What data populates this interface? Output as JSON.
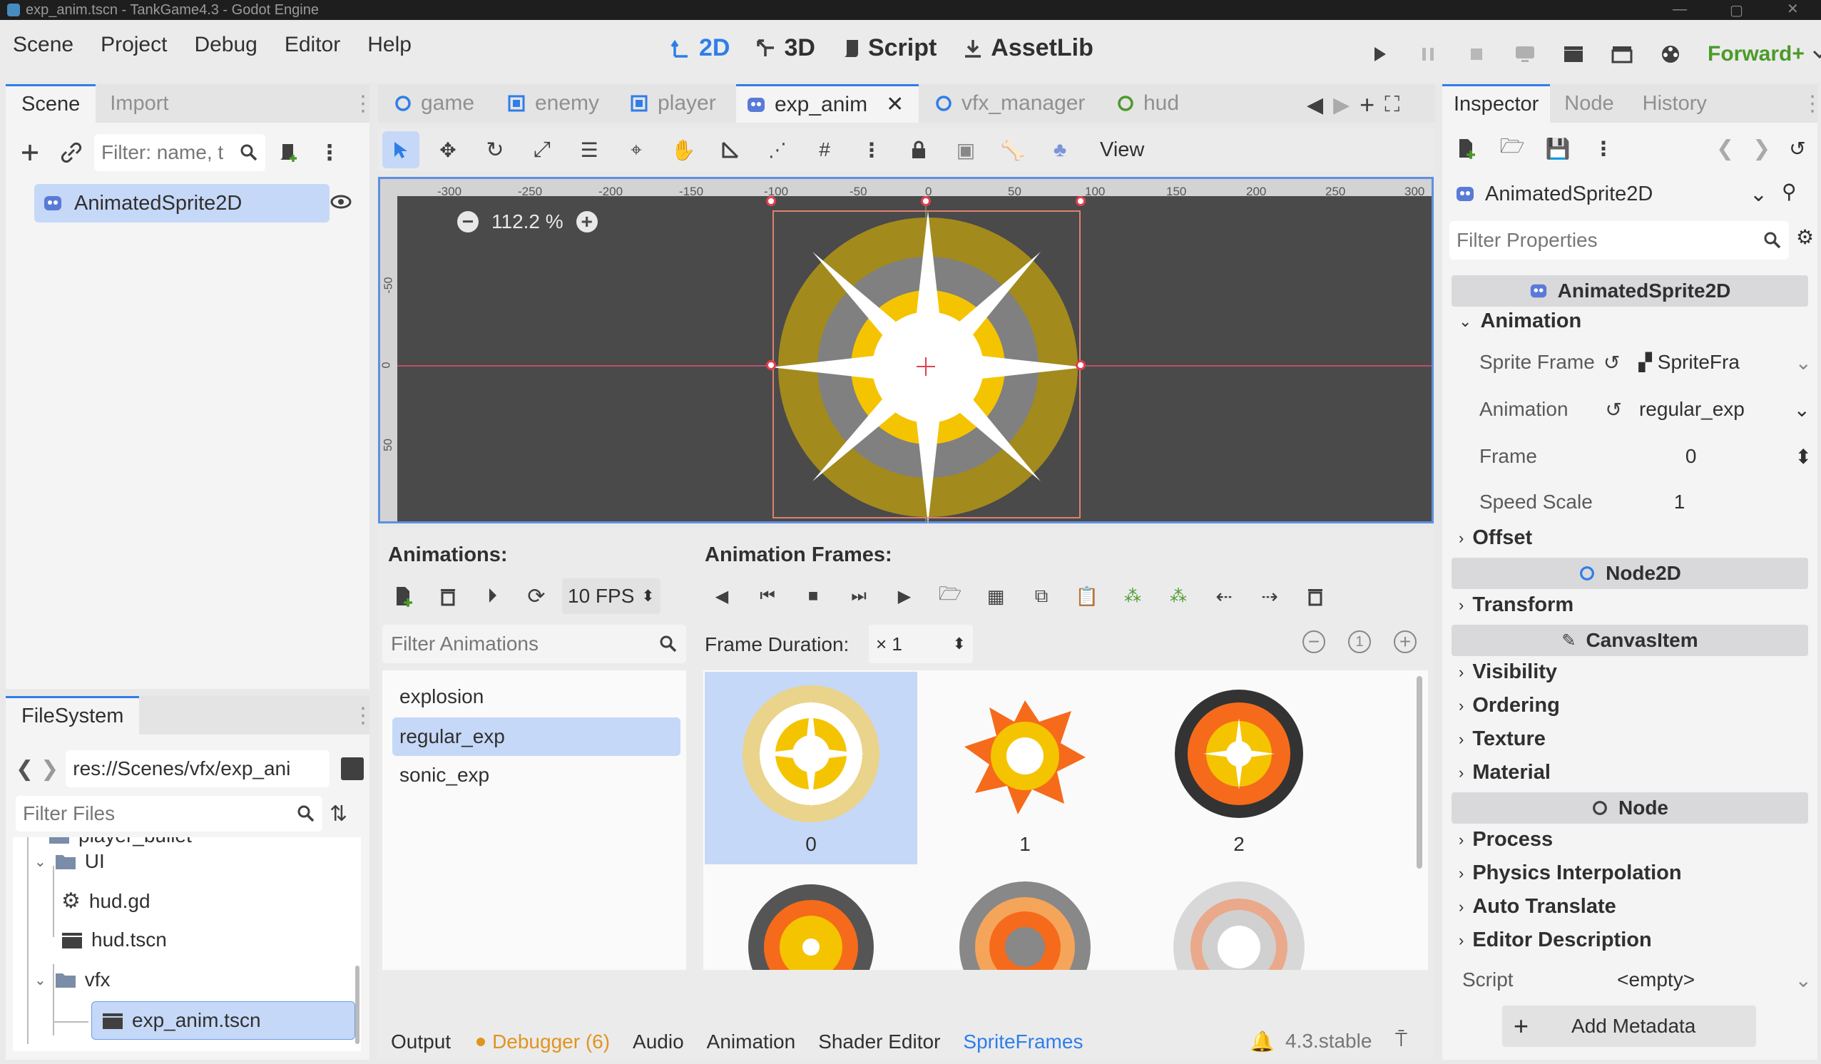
{
  "window": {
    "title": "exp_anim.tscn - TankGame4.3 - Godot Engine"
  },
  "menu": [
    "Scene",
    "Project",
    "Debug",
    "Editor",
    "Help"
  ],
  "workspaces": {
    "twod": "2D",
    "threed": "3D",
    "script": "Script",
    "assetlib": "AssetLib"
  },
  "renderer": "Forward+",
  "scene_dock": {
    "tabs": [
      "Scene",
      "Import"
    ],
    "filter_placeholder": "Filter: name, t",
    "tree": [
      {
        "label": "AnimatedSprite2D"
      }
    ]
  },
  "filesystem": {
    "tab": "FileSystem",
    "path": "res://Scenes/vfx/exp_ani",
    "filter_placeholder": "Filter Files",
    "items": [
      {
        "label": "player_bullet",
        "icon": "folder-icon"
      },
      {
        "label": "UI",
        "icon": "folder-icon"
      },
      {
        "label": "hud.gd",
        "icon": "gear-icon"
      },
      {
        "label": "hud.tscn",
        "icon": "clapper-icon"
      },
      {
        "label": "vfx",
        "icon": "folder-icon"
      },
      {
        "label": "exp_anim.tscn",
        "icon": "clapper-icon"
      }
    ]
  },
  "scene_tabs": [
    {
      "label": "game",
      "icon": "circle-icon"
    },
    {
      "label": "enemy",
      "icon": "reference-rect-icon"
    },
    {
      "label": "player",
      "icon": "reference-rect-icon"
    },
    {
      "label": "exp_anim",
      "icon": "animated-sprite-icon",
      "active": true
    },
    {
      "label": "vfx_manager",
      "icon": "circle-icon"
    },
    {
      "label": "hud",
      "icon": "control-icon"
    }
  ],
  "viewport": {
    "toolbar_view": "View",
    "zoom": "112.2 %",
    "hruler": [
      "-300",
      "-250",
      "-200",
      "-150",
      "-100",
      "-50",
      "0",
      "50",
      "100",
      "150",
      "200",
      "250",
      "300"
    ],
    "vruler": [
      "-50",
      "0",
      "50"
    ]
  },
  "spriteframes": {
    "animations_label": "Animations:",
    "frames_label": "Animation Frames:",
    "fps": "10 FPS",
    "filter_placeholder": "Filter Animations",
    "frame_duration_label": "Frame Duration:",
    "frame_duration_value": "× 1",
    "animations": [
      "explosion",
      "regular_exp",
      "sonic_exp"
    ],
    "frames": [
      "0",
      "1",
      "2"
    ]
  },
  "bottom_panel": {
    "tabs": [
      "Output",
      "Debugger (6)",
      "Audio",
      "Animation",
      "Shader Editor",
      "SpriteFrames"
    ],
    "version": "4.3.stable"
  },
  "inspector": {
    "tabs": [
      "Inspector",
      "Node",
      "History"
    ],
    "object": "AnimatedSprite2D",
    "filter_placeholder": "Filter Properties",
    "class_header": "AnimatedSprite2D",
    "animation_cat": "Animation",
    "props": {
      "sprite_frames": {
        "label": "Sprite Frame",
        "value": "SpriteFra"
      },
      "animation": {
        "label": "Animation",
        "value": "regular_exp"
      },
      "frame": {
        "label": "Frame",
        "value": "0"
      },
      "speed_scale": {
        "label": "Speed Scale",
        "value": "1"
      }
    },
    "offset": "Offset",
    "node2d": "Node2D",
    "transform": "Transform",
    "canvasitem": "CanvasItem",
    "canvas_cats": [
      "Visibility",
      "Ordering",
      "Texture",
      "Material"
    ],
    "node": "Node",
    "node_cats": [
      "Process",
      "Physics Interpolation",
      "Auto Translate",
      "Editor Description"
    ],
    "script_label": "Script",
    "script_value": "<empty>",
    "add_metadata": "Add Metadata"
  },
  "colors": {
    "accent": "#2f7ee8",
    "selection": "#c6d8f7",
    "debugger": "#e0941e",
    "viewport_bg": "#4a4a4a"
  }
}
